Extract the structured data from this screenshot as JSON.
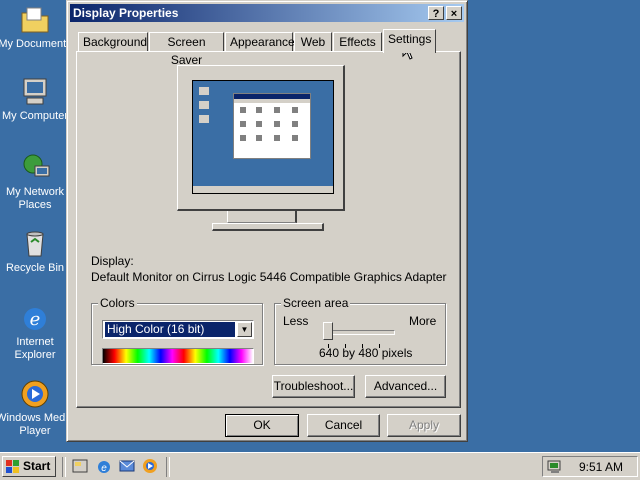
{
  "desktop": {
    "icons": [
      {
        "label": "My Documents",
        "icon": "folder-documents-icon"
      },
      {
        "label": "My Computer",
        "icon": "computer-icon"
      },
      {
        "label": "My Network Places",
        "icon": "network-places-icon"
      },
      {
        "label": "Recycle Bin",
        "icon": "recycle-bin-icon"
      },
      {
        "label": "Internet Explorer",
        "icon": "internet-explorer-icon"
      },
      {
        "label": "Windows Media Player",
        "icon": "media-player-icon"
      }
    ]
  },
  "window": {
    "title": "Display Properties",
    "help_label": "?",
    "close_label": "×",
    "tabs": [
      "Background",
      "Screen Saver",
      "Appearance",
      "Web",
      "Effects",
      "Settings"
    ],
    "active_tab": "Settings",
    "display_label": "Display:",
    "display_value": "Default Monitor on Cirrus Logic 5446 Compatible Graphics Adapter",
    "colors": {
      "label": "Colors",
      "selected": "High Color (16 bit)"
    },
    "screen_area": {
      "label": "Screen area",
      "less": "Less",
      "more": "More",
      "value_text": "640 by 480 pixels",
      "slider_position": 0
    },
    "buttons": {
      "troubleshoot": "Troubleshoot...",
      "advanced": "Advanced...",
      "ok": "OK",
      "cancel": "Cancel",
      "apply": "Apply"
    }
  },
  "taskbar": {
    "start_label": "Start",
    "quick_launch": [
      "desktop-icon",
      "internet-explorer-icon",
      "outlook-icon",
      "media-player-icon"
    ],
    "clock": "9:51 AM"
  },
  "colors": {
    "desktop": "#3a6ea5",
    "titlebar_start": "#0a246a",
    "titlebar_end": "#a6caf0",
    "face": "#d4d0c8"
  }
}
